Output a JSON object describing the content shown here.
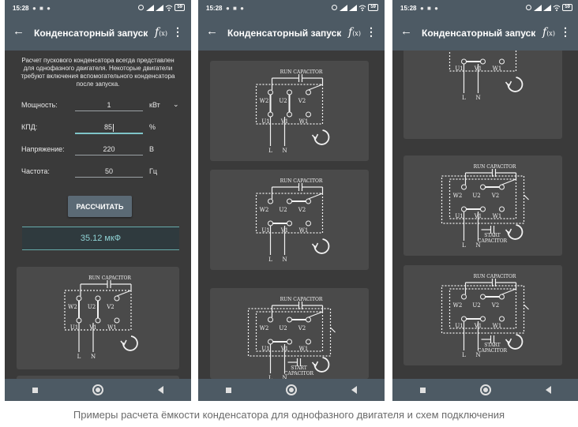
{
  "status": {
    "time": "15:28",
    "notif": "● ■ ●",
    "battery": "59"
  },
  "app": {
    "title": "Конденсаторный запуск",
    "fx": "f",
    "fx_sub": "(x)"
  },
  "calculator": {
    "info": "Расчет пускового конденсатора всегда представлен для однофазного двигателя. Некоторые двигатели требуют включения вспомогательного конденсатора после запуска.",
    "fields": [
      {
        "label": "Мощность:",
        "value": "1",
        "unit": "кВт"
      },
      {
        "label": "КПД:",
        "value": "85",
        "unit": "%"
      },
      {
        "label": "Напряжение:",
        "value": "220",
        "unit": "В"
      },
      {
        "label": "Частота:",
        "value": "50",
        "unit": "Гц"
      }
    ],
    "button": "РАССЧИТАТЬ",
    "result": "35.12 мкФ"
  },
  "diagram_labels": {
    "run": "RUN CAPACITOR",
    "start": "START",
    "start2": "CAPACITOR",
    "w2": "W2",
    "u2": "U2",
    "v2": "V2",
    "u1": "U1",
    "v1": "V1",
    "w1": "W1",
    "l": "L",
    "n": "N"
  },
  "caption": "Примеры расчета ёмкости конденсатора для однофазного двигателя и схем подключения"
}
